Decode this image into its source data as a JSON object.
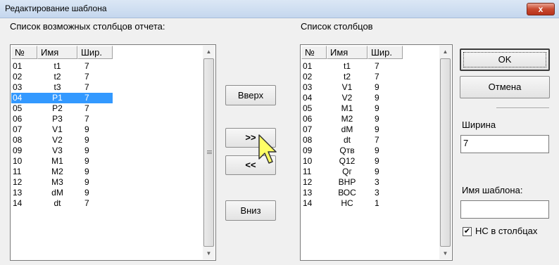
{
  "window": {
    "title": "Редактирование шаблона",
    "close_label": "x"
  },
  "available": {
    "label": "Список возможных столбцов отчета:",
    "headers": [
      "№",
      "Имя",
      "Шир."
    ],
    "selected_index": 3,
    "rows": [
      [
        "01",
        "t1",
        "7"
      ],
      [
        "02",
        "t2",
        "7"
      ],
      [
        "03",
        "t3",
        "7"
      ],
      [
        "04",
        "P1",
        "7"
      ],
      [
        "05",
        "P2",
        "7"
      ],
      [
        "06",
        "P3",
        "7"
      ],
      [
        "07",
        "V1",
        "9"
      ],
      [
        "08",
        "V2",
        "9"
      ],
      [
        "09",
        "V3",
        "9"
      ],
      [
        "10",
        "M1",
        "9"
      ],
      [
        "11",
        "M2",
        "9"
      ],
      [
        "12",
        "M3",
        "9"
      ],
      [
        "13",
        "dM",
        "9"
      ],
      [
        "14",
        "dt",
        "7"
      ]
    ]
  },
  "columns": {
    "label": "Список столбцов",
    "headers": [
      "№",
      "Имя",
      "Шир."
    ],
    "rows": [
      [
        "01",
        "t1",
        "7"
      ],
      [
        "02",
        "t2",
        "7"
      ],
      [
        "03",
        "V1",
        "9"
      ],
      [
        "04",
        "V2",
        "9"
      ],
      [
        "05",
        "M1",
        "9"
      ],
      [
        "06",
        "M2",
        "9"
      ],
      [
        "07",
        "dM",
        "9"
      ],
      [
        "08",
        "dt",
        "7"
      ],
      [
        "09",
        "Qтв",
        "9"
      ],
      [
        "10",
        "Q12",
        "9"
      ],
      [
        "11",
        "Qг",
        "9"
      ],
      [
        "12",
        "ВНР",
        "3"
      ],
      [
        "13",
        "ВОС",
        "3"
      ],
      [
        "14",
        "НС",
        "1"
      ]
    ]
  },
  "buttons": {
    "up": "Вверх",
    "add": ">>",
    "remove": "<<",
    "down": "Вниз",
    "ok": "OK",
    "cancel": "Отмена"
  },
  "width": {
    "label": "Ширина",
    "value": "7"
  },
  "template_name": {
    "label": "Имя шаблона:",
    "value": ""
  },
  "hs_checkbox": {
    "label": "НС в столбцах",
    "checked": true,
    "mark": "✔"
  }
}
